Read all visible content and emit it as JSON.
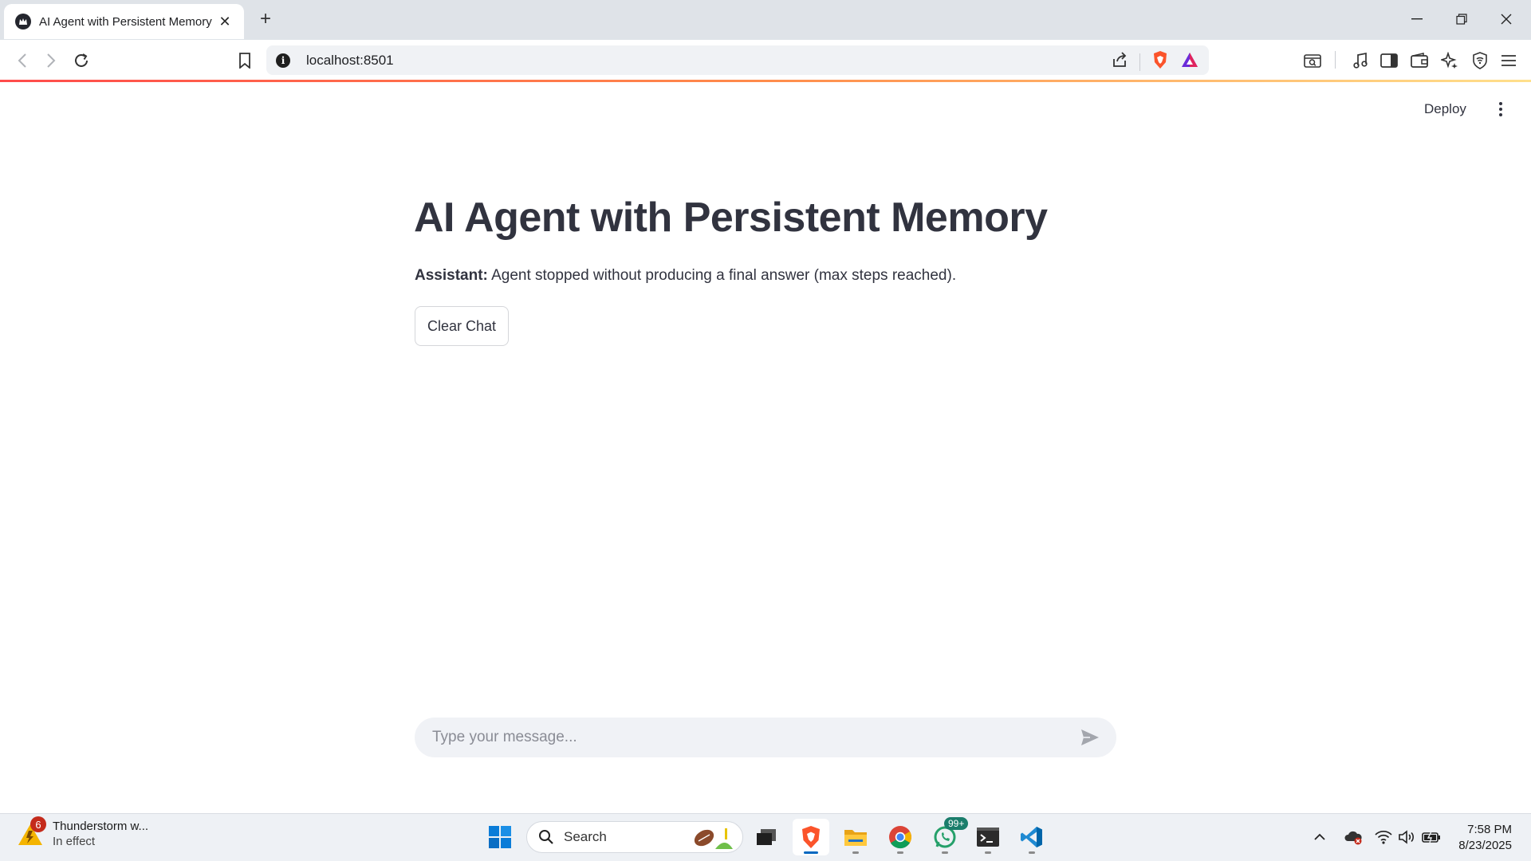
{
  "browser": {
    "tab_title": "AI Agent with Persistent Memory",
    "url": "localhost:8501"
  },
  "app": {
    "deploy_label": "Deploy",
    "title": "AI Agent with Persistent Memory",
    "message": {
      "speaker": "Assistant:",
      "text": "Agent stopped without producing a final answer (max steps reached)."
    },
    "clear_button": "Clear Chat",
    "chat_placeholder": "Type your message..."
  },
  "taskbar": {
    "weather_title": "Thunderstorm w...",
    "weather_sub": "In effect",
    "weather_badge": "6",
    "search_label": "Search",
    "whatsapp_badge": "99+",
    "time": "7:58 PM",
    "date": "8/23/2025"
  },
  "colors": {
    "text": "#31333f",
    "accent": "#ff4b4b",
    "input_bg": "#f0f2f6"
  }
}
